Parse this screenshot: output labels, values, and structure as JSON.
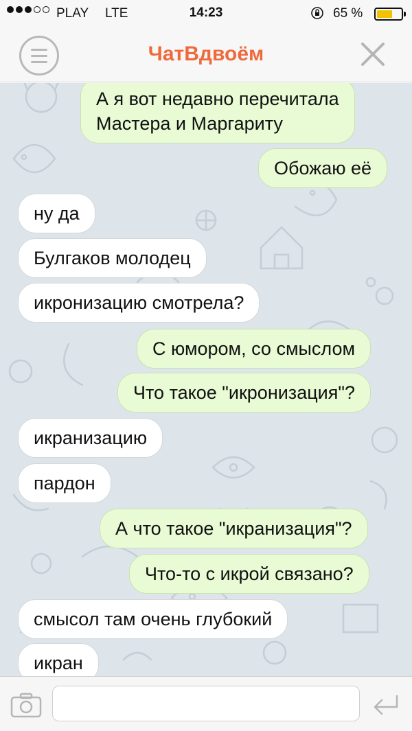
{
  "status_bar": {
    "carrier": "PLAY",
    "network": "LTE",
    "time": "14:23",
    "battery": "65 %",
    "battery_level": 0.65
  },
  "header": {
    "title": "ЧатВдвоём"
  },
  "messages": [
    {
      "direction": "out",
      "text_lines": [
        "А я вот недавно перечитала",
        "Мастера и Маргариту"
      ]
    },
    {
      "direction": "out",
      "text": "Обожаю её"
    },
    {
      "direction": "in",
      "text": "ну да"
    },
    {
      "direction": "in",
      "text": "Булгаков молодец"
    },
    {
      "direction": "in",
      "text": "икронизацию смотрела?"
    },
    {
      "direction": "out",
      "text": "С юмором, со смыслом"
    },
    {
      "direction": "out",
      "text": "Что такое \"икронизация\"?"
    },
    {
      "direction": "in",
      "text": "икранизацию"
    },
    {
      "direction": "in",
      "text": "пардон"
    },
    {
      "direction": "out",
      "text": "А что такое \"икранизация\"?"
    },
    {
      "direction": "out",
      "text": "Что-то с икрой связано?"
    },
    {
      "direction": "in",
      "text": "смысол там очень глубокий"
    },
    {
      "direction": "in",
      "text": "икран"
    }
  ],
  "input": {
    "value": "",
    "placeholder": ""
  },
  "colors": {
    "title": "#ee6a3c",
    "outgoing_bubble": "#e8fbd5",
    "incoming_bubble": "#ffffff",
    "chat_background": "#dde4ea"
  },
  "icons": {
    "menu": "menu-icon",
    "close": "close-icon",
    "camera": "camera-icon",
    "send": "send-icon",
    "lock": "rotation-lock-icon"
  }
}
